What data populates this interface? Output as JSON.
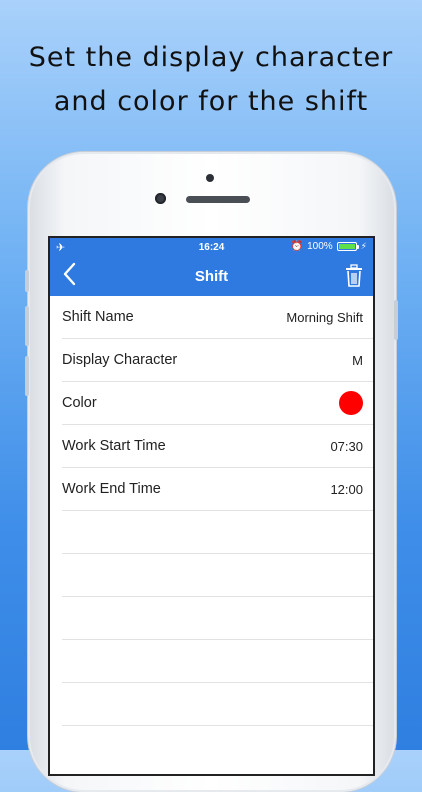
{
  "headline": {
    "line1": "Set the display character",
    "line2": "and color for the shift"
  },
  "statusbar": {
    "left_icon": "airplane-icon",
    "time": "16:24",
    "battery_percent": "100%",
    "alarm_icon": "alarm-icon"
  },
  "navbar": {
    "title": "Shift",
    "back_icon": "chevron-left-icon",
    "delete_icon": "trash-icon"
  },
  "rows": [
    {
      "label": "Shift Name",
      "value": "Morning Shift"
    },
    {
      "label": "Display Character",
      "value": "M"
    },
    {
      "label": "Color",
      "value_color": "#ff0000"
    },
    {
      "label": "Work Start Time",
      "value": "07:30"
    },
    {
      "label": "Work End Time",
      "value": "12:00"
    }
  ],
  "colors": {
    "accent": "#2f7ae0",
    "shift_color": "#ff0000"
  }
}
